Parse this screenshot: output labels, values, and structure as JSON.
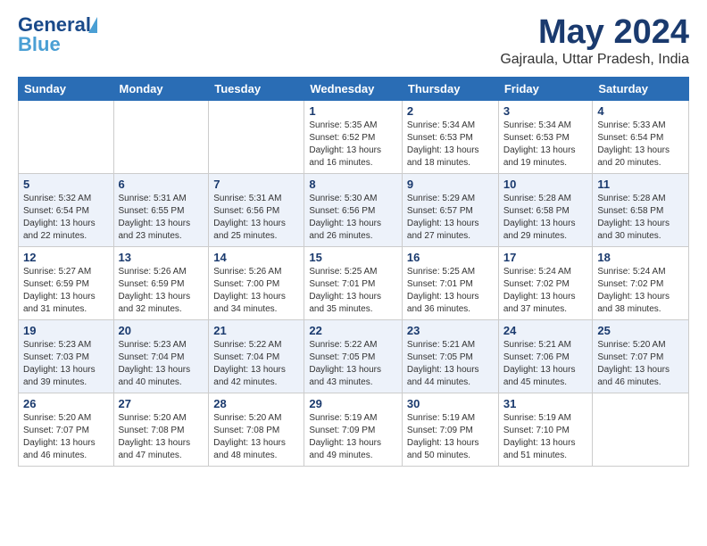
{
  "header": {
    "logo_line1": "General",
    "logo_line2": "Blue",
    "month_title": "May 2024",
    "location": "Gajraula, Uttar Pradesh, India"
  },
  "days_of_week": [
    "Sunday",
    "Monday",
    "Tuesday",
    "Wednesday",
    "Thursday",
    "Friday",
    "Saturday"
  ],
  "weeks": [
    {
      "days": [
        {
          "num": "",
          "info": ""
        },
        {
          "num": "",
          "info": ""
        },
        {
          "num": "",
          "info": ""
        },
        {
          "num": "1",
          "info": "Sunrise: 5:35 AM\nSunset: 6:52 PM\nDaylight: 13 hours\nand 16 minutes."
        },
        {
          "num": "2",
          "info": "Sunrise: 5:34 AM\nSunset: 6:53 PM\nDaylight: 13 hours\nand 18 minutes."
        },
        {
          "num": "3",
          "info": "Sunrise: 5:34 AM\nSunset: 6:53 PM\nDaylight: 13 hours\nand 19 minutes."
        },
        {
          "num": "4",
          "info": "Sunrise: 5:33 AM\nSunset: 6:54 PM\nDaylight: 13 hours\nand 20 minutes."
        }
      ]
    },
    {
      "days": [
        {
          "num": "5",
          "info": "Sunrise: 5:32 AM\nSunset: 6:54 PM\nDaylight: 13 hours\nand 22 minutes."
        },
        {
          "num": "6",
          "info": "Sunrise: 5:31 AM\nSunset: 6:55 PM\nDaylight: 13 hours\nand 23 minutes."
        },
        {
          "num": "7",
          "info": "Sunrise: 5:31 AM\nSunset: 6:56 PM\nDaylight: 13 hours\nand 25 minutes."
        },
        {
          "num": "8",
          "info": "Sunrise: 5:30 AM\nSunset: 6:56 PM\nDaylight: 13 hours\nand 26 minutes."
        },
        {
          "num": "9",
          "info": "Sunrise: 5:29 AM\nSunset: 6:57 PM\nDaylight: 13 hours\nand 27 minutes."
        },
        {
          "num": "10",
          "info": "Sunrise: 5:28 AM\nSunset: 6:58 PM\nDaylight: 13 hours\nand 29 minutes."
        },
        {
          "num": "11",
          "info": "Sunrise: 5:28 AM\nSunset: 6:58 PM\nDaylight: 13 hours\nand 30 minutes."
        }
      ]
    },
    {
      "days": [
        {
          "num": "12",
          "info": "Sunrise: 5:27 AM\nSunset: 6:59 PM\nDaylight: 13 hours\nand 31 minutes."
        },
        {
          "num": "13",
          "info": "Sunrise: 5:26 AM\nSunset: 6:59 PM\nDaylight: 13 hours\nand 32 minutes."
        },
        {
          "num": "14",
          "info": "Sunrise: 5:26 AM\nSunset: 7:00 PM\nDaylight: 13 hours\nand 34 minutes."
        },
        {
          "num": "15",
          "info": "Sunrise: 5:25 AM\nSunset: 7:01 PM\nDaylight: 13 hours\nand 35 minutes."
        },
        {
          "num": "16",
          "info": "Sunrise: 5:25 AM\nSunset: 7:01 PM\nDaylight: 13 hours\nand 36 minutes."
        },
        {
          "num": "17",
          "info": "Sunrise: 5:24 AM\nSunset: 7:02 PM\nDaylight: 13 hours\nand 37 minutes."
        },
        {
          "num": "18",
          "info": "Sunrise: 5:24 AM\nSunset: 7:02 PM\nDaylight: 13 hours\nand 38 minutes."
        }
      ]
    },
    {
      "days": [
        {
          "num": "19",
          "info": "Sunrise: 5:23 AM\nSunset: 7:03 PM\nDaylight: 13 hours\nand 39 minutes."
        },
        {
          "num": "20",
          "info": "Sunrise: 5:23 AM\nSunset: 7:04 PM\nDaylight: 13 hours\nand 40 minutes."
        },
        {
          "num": "21",
          "info": "Sunrise: 5:22 AM\nSunset: 7:04 PM\nDaylight: 13 hours\nand 42 minutes."
        },
        {
          "num": "22",
          "info": "Sunrise: 5:22 AM\nSunset: 7:05 PM\nDaylight: 13 hours\nand 43 minutes."
        },
        {
          "num": "23",
          "info": "Sunrise: 5:21 AM\nSunset: 7:05 PM\nDaylight: 13 hours\nand 44 minutes."
        },
        {
          "num": "24",
          "info": "Sunrise: 5:21 AM\nSunset: 7:06 PM\nDaylight: 13 hours\nand 45 minutes."
        },
        {
          "num": "25",
          "info": "Sunrise: 5:20 AM\nSunset: 7:07 PM\nDaylight: 13 hours\nand 46 minutes."
        }
      ]
    },
    {
      "days": [
        {
          "num": "26",
          "info": "Sunrise: 5:20 AM\nSunset: 7:07 PM\nDaylight: 13 hours\nand 46 minutes."
        },
        {
          "num": "27",
          "info": "Sunrise: 5:20 AM\nSunset: 7:08 PM\nDaylight: 13 hours\nand 47 minutes."
        },
        {
          "num": "28",
          "info": "Sunrise: 5:20 AM\nSunset: 7:08 PM\nDaylight: 13 hours\nand 48 minutes."
        },
        {
          "num": "29",
          "info": "Sunrise: 5:19 AM\nSunset: 7:09 PM\nDaylight: 13 hours\nand 49 minutes."
        },
        {
          "num": "30",
          "info": "Sunrise: 5:19 AM\nSunset: 7:09 PM\nDaylight: 13 hours\nand 50 minutes."
        },
        {
          "num": "31",
          "info": "Sunrise: 5:19 AM\nSunset: 7:10 PM\nDaylight: 13 hours\nand 51 minutes."
        },
        {
          "num": "",
          "info": ""
        }
      ]
    }
  ]
}
